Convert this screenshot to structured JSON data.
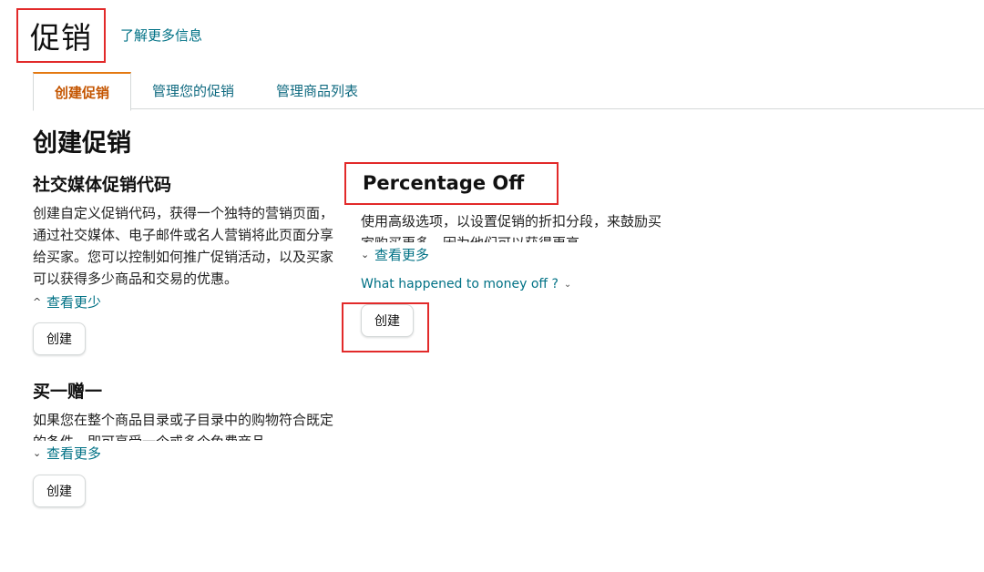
{
  "header": {
    "title": "促销",
    "learn_more": "了解更多信息"
  },
  "tabs": [
    {
      "label": "创建促销",
      "active": true
    },
    {
      "label": "管理您的促销",
      "active": false
    },
    {
      "label": "管理商品列表",
      "active": false
    }
  ],
  "section_title": "创建促销",
  "cards": {
    "social": {
      "title": "社交媒体促销代码",
      "desc": "创建自定义促销代码，获得一个独特的营销页面，通过社交媒体、电子邮件或名人营销将此页面分享给买家。您可以控制如何推广促销活动，以及买家可以获得多少商品和交易的优惠。",
      "toggle": "查看更少",
      "toggle_icon": "chevron-up-icon",
      "button": "创建"
    },
    "bogo": {
      "title": "买一赠一",
      "desc": "如果您在整个商品目录或子目录中的购物符合既定的条件，即可享受一个或多个免费商品",
      "toggle": "查看更多",
      "toggle_icon": "chevron-down-icon",
      "button": "创建"
    },
    "percentage": {
      "title": "Percentage Off",
      "desc": "使用高级选项，以设置促销的折扣分段，来鼓励买家购买更多，因为他们可以获得更高",
      "toggle": "查看更多",
      "toggle_icon": "chevron-down-icon",
      "what_happened": "What happened to money off ?",
      "button": "创建"
    }
  },
  "colors": {
    "link": "#007185",
    "active_tab": "#c45500",
    "tab_accent": "#e47911",
    "highlight": "#e22a2a"
  }
}
